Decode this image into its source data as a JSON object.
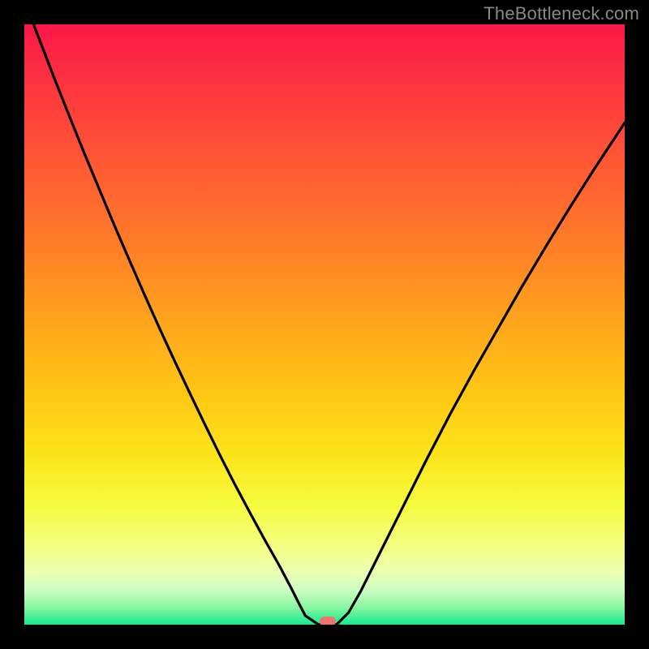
{
  "watermark": "TheBottleneck.com",
  "colors": {
    "background": "#000000",
    "curve": "#000000",
    "marker": "#f0746d"
  },
  "chart_data": {
    "type": "line",
    "title": "",
    "xlabel": "",
    "ylabel": "",
    "xlim": [
      0,
      1
    ],
    "ylim": [
      0,
      1
    ],
    "grid": false,
    "legend": false,
    "series": [
      {
        "name": "bottleneck-curve",
        "x": [
          0.0,
          0.025,
          0.05,
          0.075,
          0.1,
          0.125,
          0.15,
          0.175,
          0.2,
          0.225,
          0.25,
          0.275,
          0.3,
          0.325,
          0.35,
          0.375,
          0.4,
          0.425,
          0.445,
          0.455,
          0.468,
          0.49,
          0.52,
          0.54,
          0.56,
          0.59,
          0.63,
          0.67,
          0.71,
          0.75,
          0.79,
          0.83,
          0.87,
          0.91,
          0.95,
          1.0
        ],
        "y": [
          1.04,
          0.975,
          0.91,
          0.847,
          0.785,
          0.725,
          0.665,
          0.607,
          0.55,
          0.494,
          0.44,
          0.387,
          0.335,
          0.284,
          0.235,
          0.188,
          0.142,
          0.098,
          0.06,
          0.04,
          0.015,
          0.0,
          0.0,
          0.02,
          0.055,
          0.115,
          0.195,
          0.275,
          0.352,
          0.425,
          0.495,
          0.565,
          0.632,
          0.697,
          0.76,
          0.836
        ]
      }
    ],
    "marker": {
      "x": 0.505,
      "y": 0.0
    },
    "gradient_stops": [
      {
        "pos": 0.0,
        "color": "#fb1748"
      },
      {
        "pos": 0.12,
        "color": "#fd3a3d"
      },
      {
        "pos": 0.25,
        "color": "#ff5d33"
      },
      {
        "pos": 0.38,
        "color": "#ff8126"
      },
      {
        "pos": 0.5,
        "color": "#ffa61c"
      },
      {
        "pos": 0.62,
        "color": "#ffc814"
      },
      {
        "pos": 0.72,
        "color": "#fbe51a"
      },
      {
        "pos": 0.8,
        "color": "#f6fb3f"
      },
      {
        "pos": 0.86,
        "color": "#f4fe77"
      },
      {
        "pos": 0.91,
        "color": "#ecffae"
      },
      {
        "pos": 0.94,
        "color": "#d0fec2"
      },
      {
        "pos": 0.97,
        "color": "#8df6a2"
      },
      {
        "pos": 1.0,
        "color": "#14ea8e"
      }
    ]
  }
}
